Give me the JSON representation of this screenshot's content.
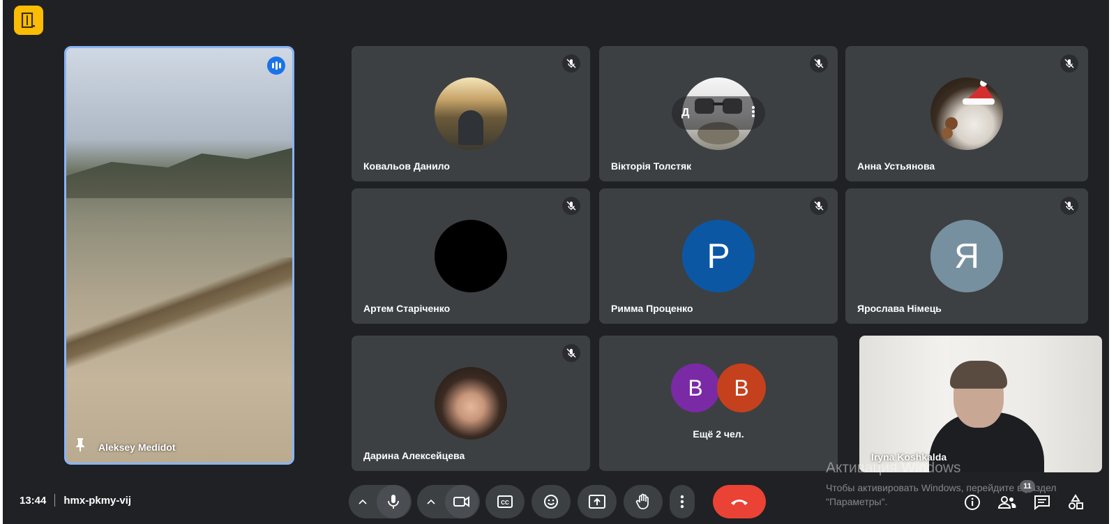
{
  "meeting": {
    "time": "13:44",
    "code": "hmx-pkmy-vij"
  },
  "pinned": {
    "name": "Aleksey Medidot"
  },
  "participants": [
    {
      "name": "Ковальов Данило"
    },
    {
      "name": "Вікторія Толстяк",
      "overlay_letter": "Д"
    },
    {
      "name": "Анна Устьянова"
    },
    {
      "name": "Артем Старіченко"
    },
    {
      "name": "Римма Проценко",
      "initial": "Р",
      "color": "#0b57a4"
    },
    {
      "name": "Ярослава Німець",
      "initial": "Я",
      "color": "#7790a0"
    },
    {
      "name": "Дарина Алексейцева"
    }
  ],
  "others": {
    "label": "Ещё 2 чел.",
    "avatars": [
      {
        "initial": "В",
        "color": "#7b2aa6"
      },
      {
        "initial": "В",
        "color": "#c5401d"
      }
    ]
  },
  "self": {
    "name": "Iryna Koshkalda"
  },
  "people_count": "11",
  "windows_activation": {
    "title": "Активация Windows",
    "subtitle": "Чтобы активировать Windows, перейдите в раздел \"Параметры\"."
  },
  "colors": {
    "background": "#202124",
    "tile": "#3c4043",
    "hangup": "#ea4335",
    "speaking": "#1a73e8"
  },
  "icons": [
    "mic-icon",
    "camera-icon",
    "captions-icon",
    "emoji-icon",
    "present-icon",
    "raise-hand-icon",
    "more-icon",
    "hangup-icon",
    "info-icon",
    "people-icon",
    "chat-icon",
    "activities-icon"
  ]
}
